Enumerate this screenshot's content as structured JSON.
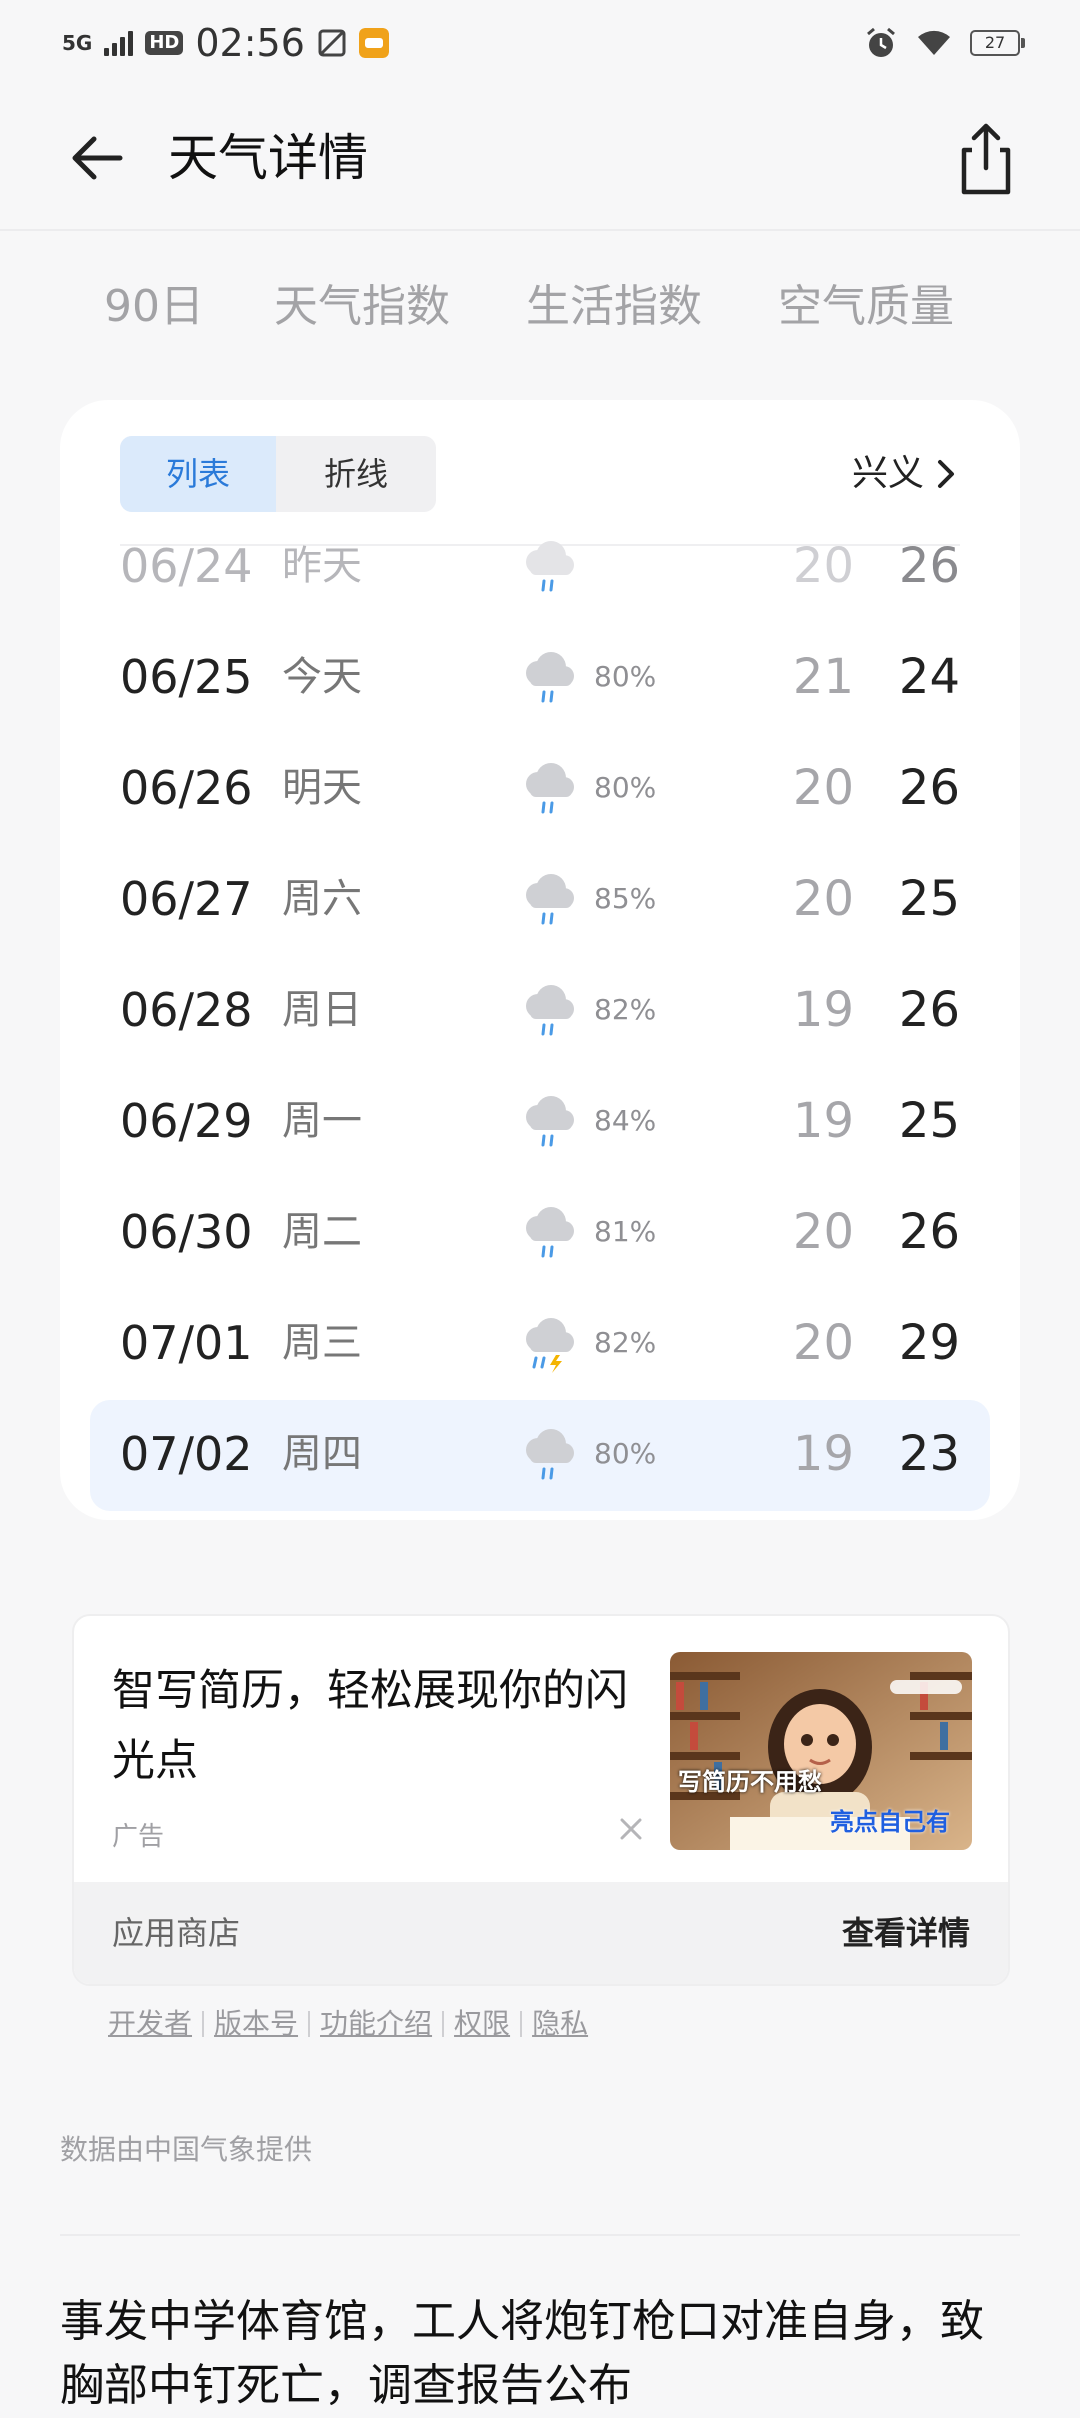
{
  "status_bar": {
    "signal": "5G",
    "hd": "HD",
    "time": "02:56",
    "battery": "27"
  },
  "header": {
    "title": "天气详情"
  },
  "tabs": [
    "90日",
    "天气指数",
    "生活指数",
    "空气质量"
  ],
  "forecast": {
    "view_list": "列表",
    "view_line": "折线",
    "location": "兴义",
    "rows": [
      {
        "date": "06/24",
        "day": "昨天",
        "precip": "",
        "low": "20",
        "high": "26",
        "icon": "rain-cloud-icon"
      },
      {
        "date": "06/25",
        "day": "今天",
        "precip": "80%",
        "low": "21",
        "high": "24",
        "icon": "rain-cloud-icon"
      },
      {
        "date": "06/26",
        "day": "明天",
        "precip": "80%",
        "low": "20",
        "high": "26",
        "icon": "rain-cloud-icon"
      },
      {
        "date": "06/27",
        "day": "周六",
        "precip": "85%",
        "low": "20",
        "high": "25",
        "icon": "rain-cloud-icon"
      },
      {
        "date": "06/28",
        "day": "周日",
        "precip": "82%",
        "low": "19",
        "high": "26",
        "icon": "rain-cloud-icon"
      },
      {
        "date": "06/29",
        "day": "周一",
        "precip": "84%",
        "low": "19",
        "high": "25",
        "icon": "rain-cloud-icon"
      },
      {
        "date": "06/30",
        "day": "周二",
        "precip": "81%",
        "low": "20",
        "high": "26",
        "icon": "rain-cloud-icon"
      },
      {
        "date": "07/01",
        "day": "周三",
        "precip": "82%",
        "low": "20",
        "high": "29",
        "icon": "thunder-rain-cloud-icon"
      },
      {
        "date": "07/02",
        "day": "周四",
        "precip": "80%",
        "low": "19",
        "high": "23",
        "icon": "rain-cloud-icon"
      }
    ]
  },
  "ad": {
    "title": "智写简历，轻松展现你的闪光点",
    "tag": "广告",
    "image_text_1": "写简历不用愁",
    "image_text_2": "亮点自己有",
    "source": "应用商店",
    "detail": "查看详情",
    "links": [
      "开发者",
      "版本号",
      "功能介绍",
      "权限",
      "隐私"
    ]
  },
  "data_source": "数据由中国气象提供",
  "news": {
    "headline": "事发中学体育馆，工人将炮钉枪口对准自身，致胸部中钉死亡，调查报告公布"
  },
  "colors": {
    "accent": "#2a7ad9",
    "segment_active_bg": "#dbeafb",
    "highlight_row": "#eef4fe"
  }
}
